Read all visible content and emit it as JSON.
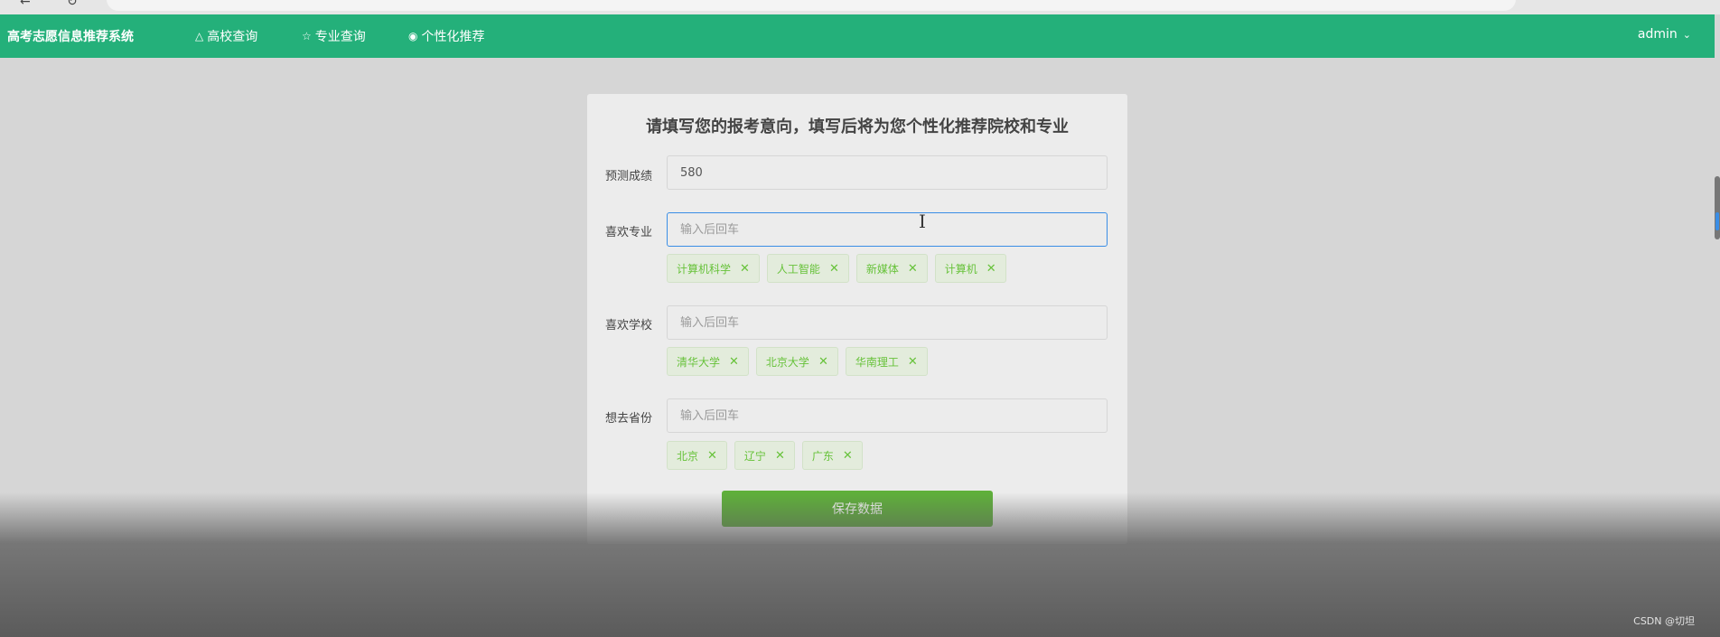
{
  "navbar": {
    "brand": "高考志愿信息推荐系统",
    "items": [
      {
        "label": "高校查询",
        "icon": "building-icon"
      },
      {
        "label": "专业查询",
        "icon": "star-icon"
      },
      {
        "label": "个性化推荐",
        "icon": "target-icon"
      }
    ],
    "user": "admin"
  },
  "form": {
    "title": "请填写您的报考意向，填写后将为您个性化推荐院校和专业",
    "score_label": "预测成绩",
    "score_value": "580",
    "major_label": "喜欢专业",
    "major_placeholder": "输入后回车",
    "major_tags": [
      "计算机科学",
      "人工智能",
      "新媒体",
      "计算机"
    ],
    "school_label": "喜欢学校",
    "school_placeholder": "输入后回车",
    "school_tags": [
      "清华大学",
      "北京大学",
      "华南理工"
    ],
    "province_label": "想去省份",
    "province_placeholder": "输入后回车",
    "province_tags": [
      "北京",
      "辽宁",
      "广东"
    ],
    "save_label": "保存数据"
  },
  "watermark": "CSDN @切坦",
  "colors": {
    "navbar": "#24b07a",
    "tag_text": "#67c23a",
    "save_button": "#5fb03a",
    "focus_border": "#3a8ee6"
  }
}
